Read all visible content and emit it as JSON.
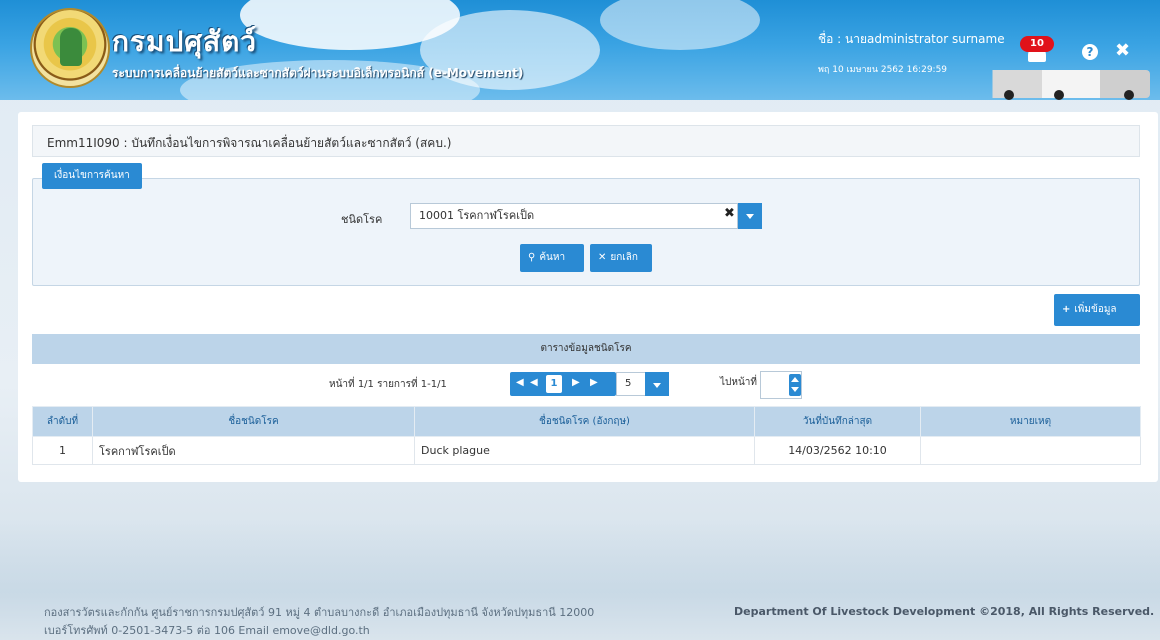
{
  "header": {
    "org_name": "กรมปศุสัตว์",
    "system_name": "ระบบการเคลื่อนย้ายสัตว์และซากสัตว์ผ่านระบบอิเล็กทรอนิกส์ (e-Movement)",
    "user_label": "ชื่อ : นายadministrator surname",
    "datetime": "พฤ 10 เมษายน 2562 16:29:59",
    "notification_count": "10",
    "help_label": "?",
    "close_label": "✖"
  },
  "page": {
    "heading": "Emm11I090 : บันทึกเงื่อนไขการพิจารณาเคลื่อนย้ายสัตว์และซากสัตว์ (สคบ.)"
  },
  "search": {
    "tab_label": "เงื่อนไขการค้นหา",
    "disease_label": "ชนิดโรค",
    "disease_value": "10001 โรคกาฬโรคเป็ด",
    "clear_label": "✖",
    "search_button": "ค้นหา",
    "cancel_button": "ยกเลิก"
  },
  "actions": {
    "add_button": "เพิ่มข้อมูล"
  },
  "table": {
    "caption": "ตารางข้อมูลชนิดโรค",
    "pager": {
      "info": "หน้าที่ 1/1 รายการที่ 1-1/1",
      "first": "◀",
      "prev": "◀",
      "current": "1",
      "next": "▶",
      "last": "▶",
      "page_size": "5",
      "goto_label": "ไปหน้าที่"
    },
    "columns": [
      "ลำดับที่",
      "ชื่อชนิดโรค",
      "ชื่อชนิดโรค (อังกฤษ)",
      "วันที่บันทึกล่าสุด",
      "หมายเหตุ"
    ],
    "rows": [
      [
        "1",
        "โรคกาฬโรคเป็ด",
        "Duck plague",
        "14/03/2562 10:10",
        ""
      ]
    ]
  },
  "footer": {
    "address": "กองสารวัตรและกักกัน ศูนย์ราชการกรมปศุสัตว์ 91 หมู่ 4 ตำบลบางกะดี อำเภอเมืองปทุมธานี จังหวัดปทุมธานี 12000",
    "contact": "เบอร์โทรศัพท์ 0-2501-3473-5 ต่อ 106 Email emove@dld.go.th",
    "copyright": "Department Of Livestock Development ©2018, All Rights Reserved."
  },
  "colors": {
    "primary": "#2a8ad3",
    "header_blue": "#1f8fd6",
    "table_header": "#bcd4e9",
    "badge_red": "#e1121a"
  }
}
